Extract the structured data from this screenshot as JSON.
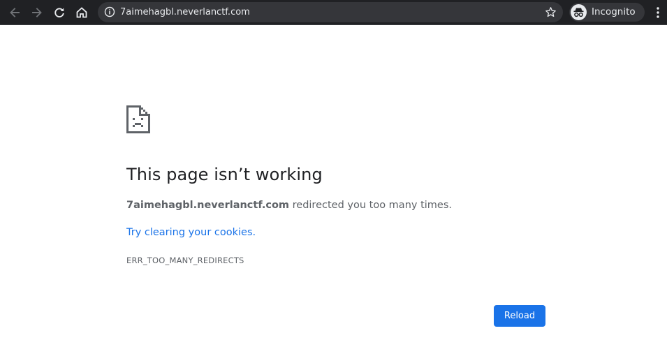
{
  "browser": {
    "url": "7aimehagbl.neverlanctf.com",
    "profile_label": "Incognito",
    "icons": {
      "back": "arrow-left-icon",
      "forward": "arrow-right-icon",
      "reload": "reload-icon",
      "home": "home-icon",
      "site_info": "info-icon",
      "bookmark": "star-icon",
      "profile": "incognito-icon",
      "menu": "vertical-dots-icon"
    },
    "colors": {
      "toolbar_bg": "#202124",
      "omnibox_bg": "#35363a",
      "toolbar_text": "#e8eaed"
    }
  },
  "error_page": {
    "icon": "sad-page-icon",
    "heading": "This page isn’t working",
    "host": "7aimehagbl.neverlanctf.com",
    "message": " redirected you too many times.",
    "suggestion_link": "Try clearing your cookies",
    "suggestion_suffix": ".",
    "error_code": "ERR_TOO_MANY_REDIRECTS",
    "reload_label": "Reload",
    "colors": {
      "heading": "#202124",
      "body_text": "#5f6368",
      "link": "#1a73e8",
      "button_bg": "#1a73e8",
      "button_text": "#ffffff"
    }
  }
}
